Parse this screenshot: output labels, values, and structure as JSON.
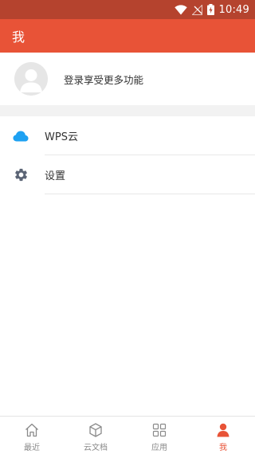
{
  "status_bar": {
    "time": "10:49",
    "icons": [
      "wifi-icon",
      "no-signal-icon",
      "battery-charging-icon"
    ]
  },
  "app_bar": {
    "title": "我"
  },
  "profile": {
    "login_prompt": "登录享受更多功能",
    "avatar_icon": "default-avatar-icon"
  },
  "menu": {
    "items": [
      {
        "label": "WPS云",
        "icon": "cloud-icon",
        "icon_color": "#1ea1f2"
      },
      {
        "label": "设置",
        "icon": "gear-icon",
        "icon_color": "#5b6475"
      }
    ]
  },
  "bottom_nav": {
    "tabs": [
      {
        "label": "最近",
        "icon": "home-icon",
        "active": false
      },
      {
        "label": "云文档",
        "icon": "cube-icon",
        "active": false
      },
      {
        "label": "应用",
        "icon": "grid-icon",
        "active": false
      },
      {
        "label": "我",
        "icon": "person-icon",
        "active": true
      }
    ]
  },
  "colors": {
    "status_bar": "#b5432e",
    "accent": "#e85337",
    "section_gap": "#f2f2f2",
    "inactive_nav": "#8a8a8a"
  }
}
